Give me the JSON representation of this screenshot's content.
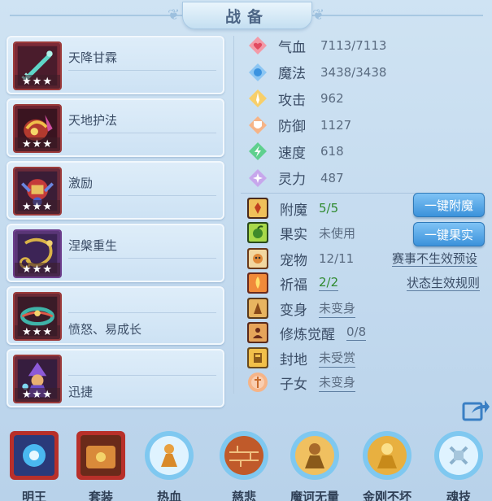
{
  "title": "战备",
  "skills": [
    {
      "name": "天降甘霖",
      "stars": "★★★"
    },
    {
      "name": "天地护法",
      "stars": "★★★"
    },
    {
      "name": "激励",
      "stars": "★★★"
    },
    {
      "name": "涅槃重生",
      "stars": "★★★"
    },
    {
      "name": "愤怒、易成长",
      "stars": "★★★"
    },
    {
      "name": "迅捷",
      "stars": "★★★"
    }
  ],
  "stats": [
    {
      "label": "气血",
      "value": "7113/7113",
      "icon": "heart-icon"
    },
    {
      "label": "魔法",
      "value": "3438/3438",
      "icon": "mana-icon"
    },
    {
      "label": "攻击",
      "value": "962",
      "icon": "attack-icon"
    },
    {
      "label": "防御",
      "value": "1127",
      "icon": "defense-icon"
    },
    {
      "label": "速度",
      "value": "618",
      "icon": "speed-icon"
    },
    {
      "label": "灵力",
      "value": "487",
      "icon": "spirit-icon"
    }
  ],
  "props": {
    "enchant": {
      "label": "附魔",
      "value": "5/5"
    },
    "fruit": {
      "label": "果实",
      "value": "未使用"
    },
    "pet": {
      "label": "宠物",
      "value": "12/11"
    },
    "blessing": {
      "label": "祈福",
      "value": "2/2"
    },
    "transform": {
      "label": "变身",
      "value": "未变身"
    },
    "awaken": {
      "label": "修炼觉醒",
      "value": "0/8"
    },
    "fief": {
      "label": "封地",
      "value": "未受赏"
    },
    "children": {
      "label": "子女",
      "value": "未变身"
    }
  },
  "buttons": {
    "enchant": "一键附魔",
    "fruit": "一键果实"
  },
  "links": {
    "event_preset": "赛事不生效预设",
    "status_rules": "状态生效规则"
  },
  "bottom": [
    {
      "label": "明王"
    },
    {
      "label": "套装"
    },
    {
      "label": "热血"
    },
    {
      "label": "慈悲"
    },
    {
      "label": "魔诃无量"
    },
    {
      "label": "金刚不坏"
    },
    {
      "label": "魂技"
    }
  ],
  "colors": {
    "accent_blue": "#3b92db",
    "green_value": "#2f8a2f",
    "card_border": "#9c3b3b"
  }
}
